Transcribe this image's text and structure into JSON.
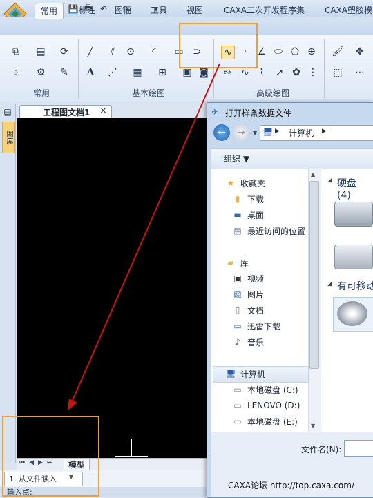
{
  "qat": {
    "icons": [
      "new-icon",
      "open-icon",
      "save-icon",
      "print-icon",
      "undo-icon",
      "redo-icon"
    ]
  },
  "tabs": [
    {
      "label": "常用",
      "active": true
    },
    {
      "label": "标注"
    },
    {
      "label": "图幅"
    },
    {
      "label": "工具"
    },
    {
      "label": "视图"
    },
    {
      "label": "CAXA二次开发程序集"
    },
    {
      "label": "CAXA塑胶模"
    }
  ],
  "ribbon": {
    "groups": [
      {
        "label": "常用"
      },
      {
        "label": "基本绘图"
      },
      {
        "label": "高级绘图"
      }
    ],
    "text_tool_label": "A"
  },
  "leftbar": {
    "label": "图库"
  },
  "document": {
    "tab_title": "工程图文档1",
    "close": "×"
  },
  "canvas_nav": {
    "model_tab": "模型"
  },
  "command": {
    "item": "1. 从文件读入"
  },
  "statusbar": {
    "prompt": "输入点:"
  },
  "dialog": {
    "title": "打开样条数据文件",
    "address": "计算机",
    "organize": "组织 ▼",
    "nav": {
      "favorites_header": "收藏夹",
      "favorites": [
        "下载",
        "桌面",
        "最近访问的位置"
      ],
      "library_header": "库",
      "libraries": [
        "视频",
        "图片",
        "文档",
        "迅雷下载",
        "音乐"
      ],
      "computer_header": "计算机",
      "drives": [
        "本地磁盘 (C:)",
        "LENOVO (D:)",
        "本地磁盘 (E:)"
      ]
    },
    "main": {
      "hard_disks": "硬盘 (4)",
      "removable": "有可移动"
    },
    "filename_label": "文件名(N):",
    "watermark": "CAXA论坛 http://top.caxa.com/"
  },
  "colors": {
    "highlight": "#f0a030",
    "arrow": "#cc1111",
    "canvas": "#000000"
  }
}
